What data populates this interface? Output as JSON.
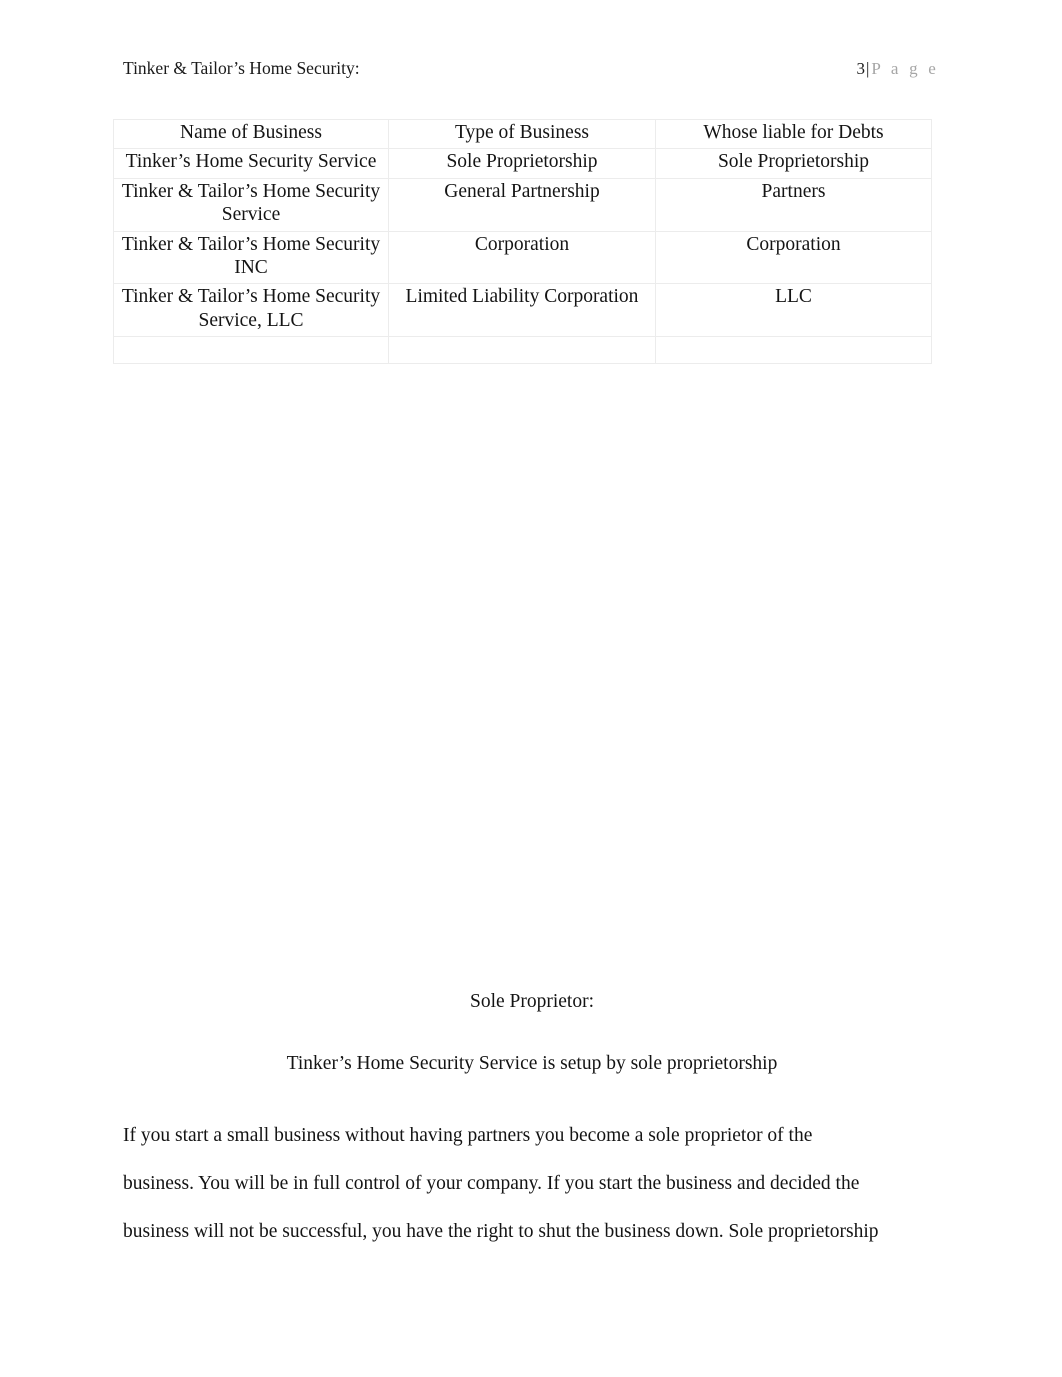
{
  "header": {
    "left_text": "Tinker & Tailor’s Home Security:",
    "page_number": "3",
    "separator": "|",
    "page_word": "P a g e"
  },
  "table": {
    "columns": [
      "Name of Business",
      "Type of Business",
      "Whose liable for Debts"
    ],
    "rows": [
      {
        "name": "Tinker’s Home Security Service",
        "type": "Sole Proprietorship",
        "liable": "Sole Proprietorship"
      },
      {
        "name": "Tinker & Tailor’s Home Security Service",
        "type": "General Partnership",
        "liable": "Partners"
      },
      {
        "name": "Tinker & Tailor’s Home Security INC",
        "type": "Corporation",
        "liable": "Corporation"
      },
      {
        "name": "Tinker & Tailor’s Home Security Service, LLC",
        "type": "Limited Liability Corporation",
        "liable": "LLC"
      },
      {
        "name": "",
        "type": "",
        "liable": ""
      }
    ]
  },
  "content": {
    "section_heading": "Sole Proprietor:",
    "section_subheading": "Tinker’s Home Security Service is setup by sole proprietorship",
    "paragraph_lines": [
      "If you start a small business without having partners you become a sole proprietor of the",
      "business. You will be in full control of your company. If you start the business and decided the",
      "business will not be successful, you have the right to shut the business down. Sole proprietorship"
    ]
  },
  "colors": {
    "page_background": "#ffffff",
    "text": "#141414",
    "muted_text": "#a6a6a6",
    "table_border": "#ececec"
  }
}
